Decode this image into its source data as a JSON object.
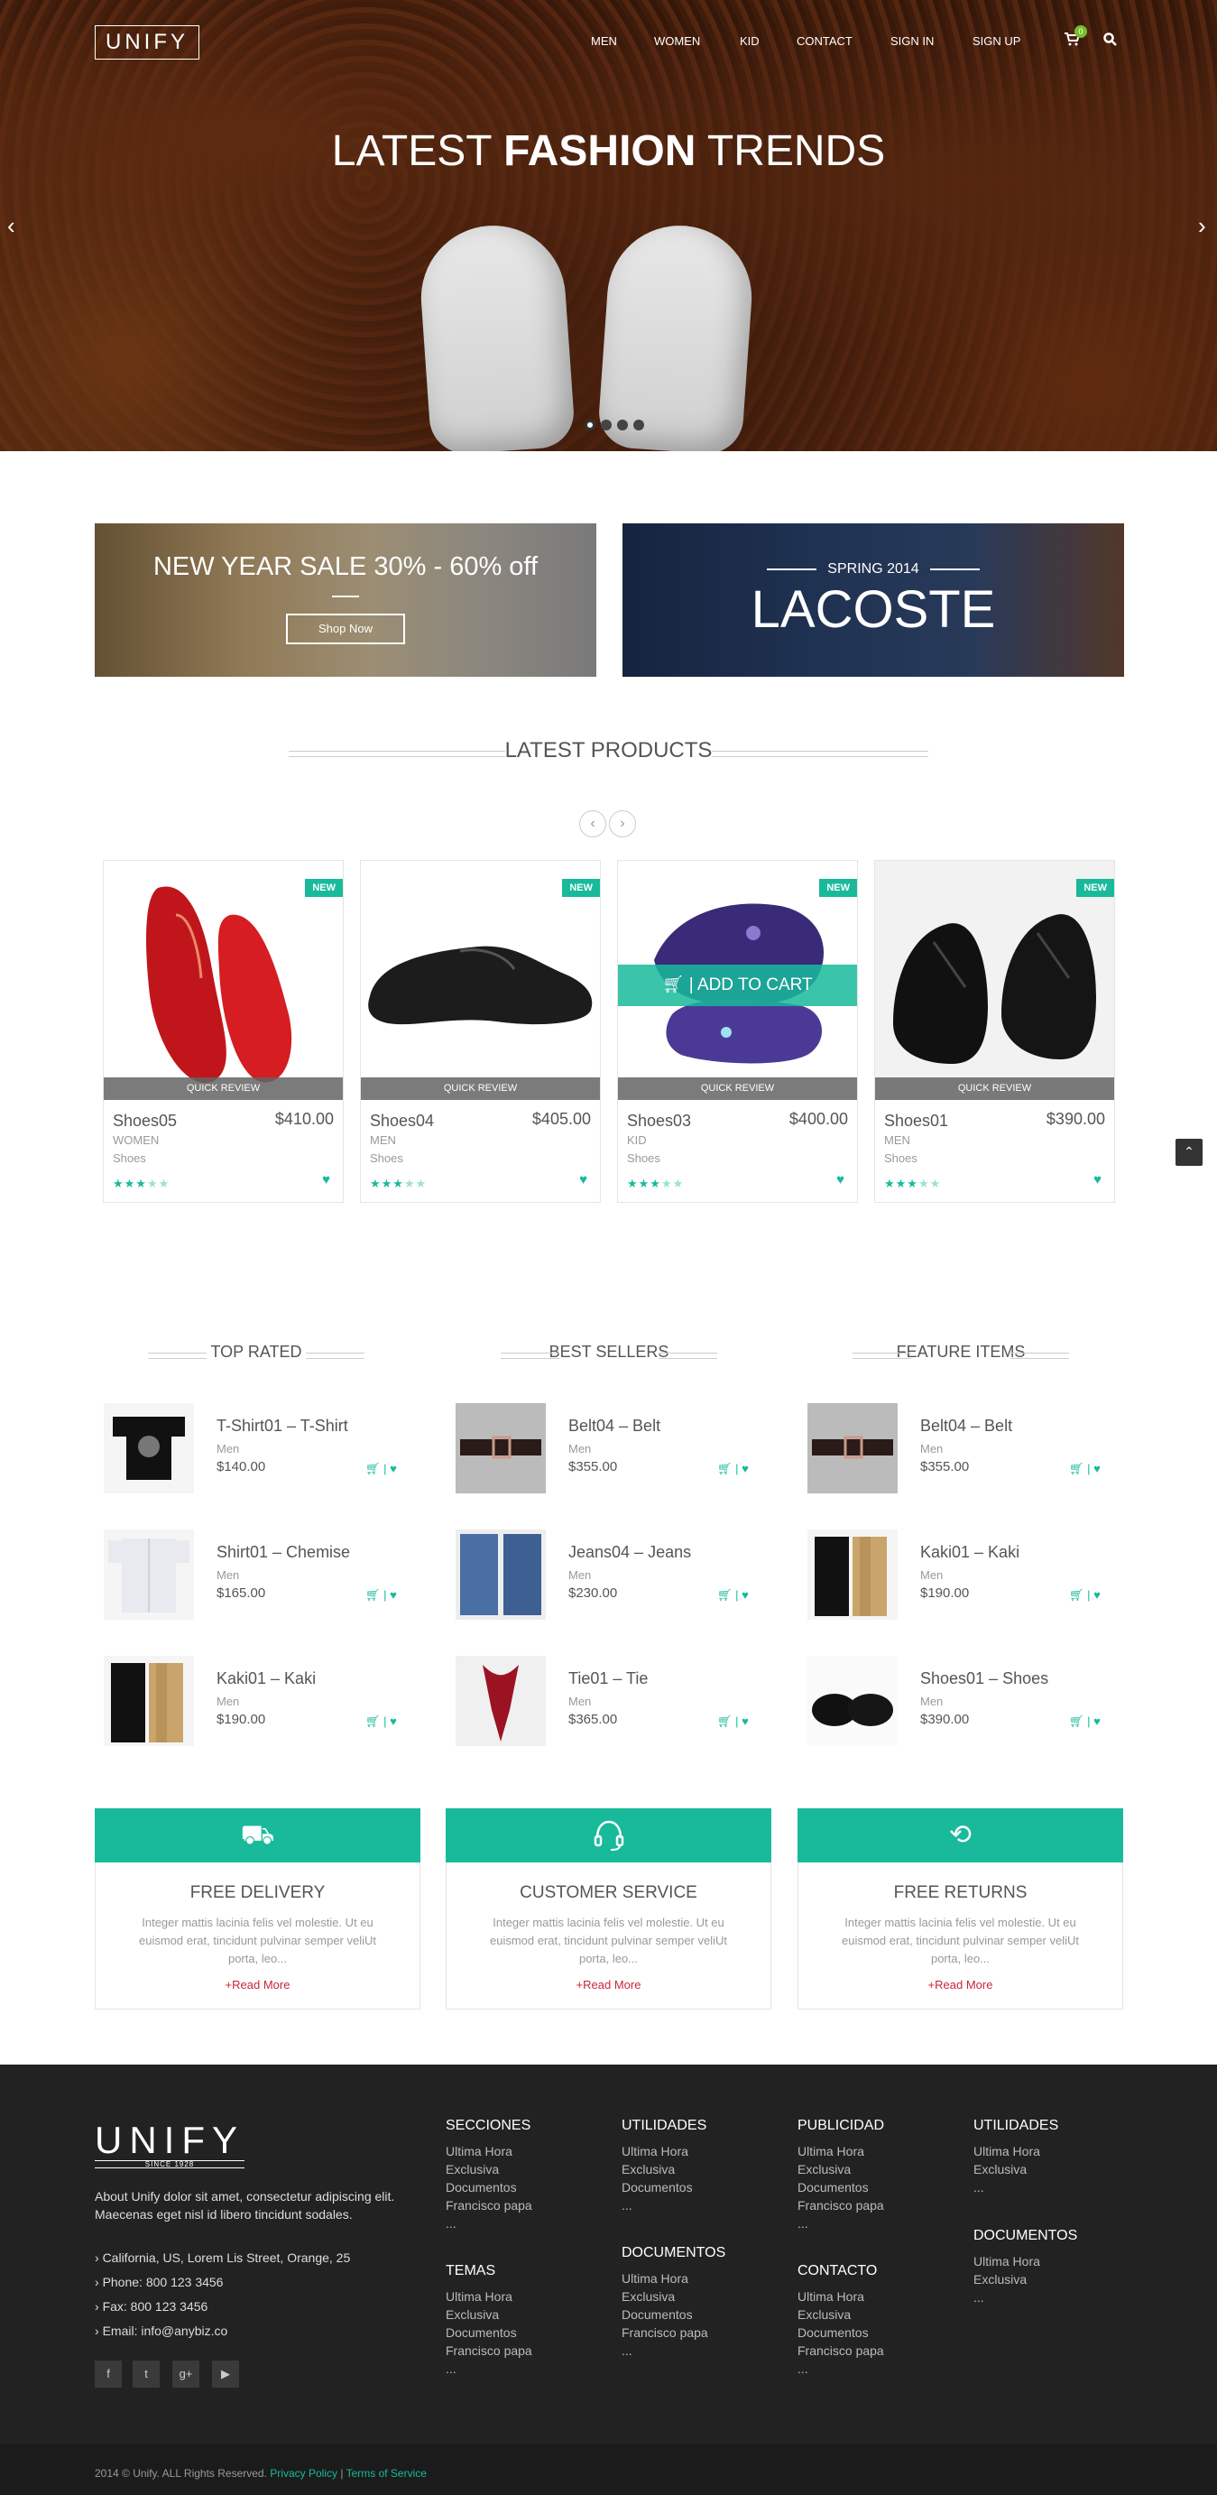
{
  "header": {
    "logo": "UNIFY",
    "nav": [
      "MEN",
      "WOMEN",
      "KID",
      "CONTACT",
      "SIGN IN",
      "SIGN UP"
    ],
    "cart_count": "0"
  },
  "hero": {
    "title_light": "LATEST ",
    "title_bold": "FASHION",
    "title_light2": " TRENDS"
  },
  "promos": {
    "sale_title": "NEW YEAR SALE 30% - 60% off",
    "sale_button": "Shop Now",
    "brand_subtitle": "SPRING 2014",
    "brand_title": "LACOSTE"
  },
  "latest": {
    "title": "LATEST PRODUCTS",
    "badge": "NEW",
    "quick_review": "QUICK REVIEW",
    "add_to_cart": "ADD TO CART",
    "products": [
      {
        "name": "Shoes05",
        "price": "$410.00",
        "group": "WOMEN",
        "cat": "Shoes",
        "rating": 3
      },
      {
        "name": "Shoes04",
        "price": "$405.00",
        "group": "MEN",
        "cat": "Shoes",
        "rating": 3
      },
      {
        "name": "Shoes03",
        "price": "$400.00",
        "group": "KID",
        "cat": "Shoes",
        "rating": 3
      },
      {
        "name": "Shoes01",
        "price": "$390.00",
        "group": "MEN",
        "cat": "Shoes",
        "rating": 3
      }
    ]
  },
  "columns": [
    {
      "title": "TOP RATED",
      "items": [
        {
          "name": "T-Shirt01 – T-Shirt",
          "cat": "Men",
          "price": "$140.00"
        },
        {
          "name": "Shirt01 – Chemise",
          "cat": "Men",
          "price": "$165.00"
        },
        {
          "name": "Kaki01 – Kaki",
          "cat": "Men",
          "price": "$190.00"
        }
      ]
    },
    {
      "title": "BEST SELLERS",
      "items": [
        {
          "name": "Belt04 – Belt",
          "cat": "Men",
          "price": "$355.00"
        },
        {
          "name": "Jeans04 – Jeans",
          "cat": "Men",
          "price": "$230.00"
        },
        {
          "name": "Tie01 – Tie",
          "cat": "Men",
          "price": "$365.00"
        }
      ]
    },
    {
      "title": "FEATURE ITEMS",
      "items": [
        {
          "name": "Belt04 – Belt",
          "cat": "Men",
          "price": "$355.00"
        },
        {
          "name": "Kaki01 – Kaki",
          "cat": "Men",
          "price": "$190.00"
        },
        {
          "name": "Shoes01 – Shoes",
          "cat": "Men",
          "price": "$390.00"
        }
      ]
    }
  ],
  "services": [
    {
      "title": "FREE DELIVERY",
      "icon": "truck-icon"
    },
    {
      "title": "CUSTOMER SERVICE",
      "icon": "headset-icon"
    },
    {
      "title": "FREE RETURNS",
      "icon": "refresh-icon"
    }
  ],
  "service_text": "Integer mattis lacinia felis vel molestie. Ut eu euismod erat, tincidunt pulvinar semper veliUt porta, leo...",
  "service_more": "+Read More",
  "footer": {
    "logo": "UNIFY",
    "since": "SINCE 1928",
    "about": "About Unify dolor sit amet, consectetur adipiscing elit. Maecenas eget nisl id libero tincidunt sodales.",
    "address": "California, US, Lorem Lis Street, Orange, 25",
    "phone": "Phone: 800 123 3456",
    "fax": "Fax: 800 123 3456",
    "email": "Email: info@anybiz.co",
    "secciones": {
      "title": "SECCIONES",
      "links": [
        "Ultima Hora",
        "Exclusiva",
        "Documentos",
        "Francisco papa",
        "..."
      ]
    },
    "temas": {
      "title": "TEMAS",
      "links": [
        "Ultima Hora",
        "Exclusiva",
        "Documentos",
        "Francisco papa",
        "..."
      ]
    },
    "utilidades": {
      "title": "UTILIDADES",
      "links": [
        "Ultima Hora",
        "Exclusiva",
        "Documentos",
        "..."
      ]
    },
    "documentos": {
      "title": "DOCUMENTOS",
      "links": [
        "Ultima Hora",
        "Exclusiva",
        "Documentos",
        "Francisco papa",
        "..."
      ]
    },
    "publicidad": {
      "title": "PUBLICIDAD",
      "links": [
        "Ultima Hora",
        "Exclusiva",
        "Documentos",
        "Francisco papa",
        "..."
      ]
    },
    "contacto": {
      "title": "CONTACTO",
      "links": [
        "Ultima Hora",
        "Exclusiva",
        "Documentos",
        "Francisco papa",
        "..."
      ]
    },
    "utilidades2": {
      "title": "UTILIDADES",
      "links": [
        "Ultima Hora",
        "Exclusiva",
        "..."
      ]
    },
    "documentos2": {
      "title": "DOCUMENTOS",
      "links": [
        "Ultima Hora",
        "Exclusiva",
        "..."
      ]
    },
    "copyright": "2014 © Unify. ALL Rights Reserved.",
    "privacy": "Privacy Policy",
    "sep": "|",
    "terms": "Terms of Service"
  },
  "colors": {
    "accent": "#18ba9b",
    "footer": "#222222",
    "link_red": "#c9253c"
  }
}
